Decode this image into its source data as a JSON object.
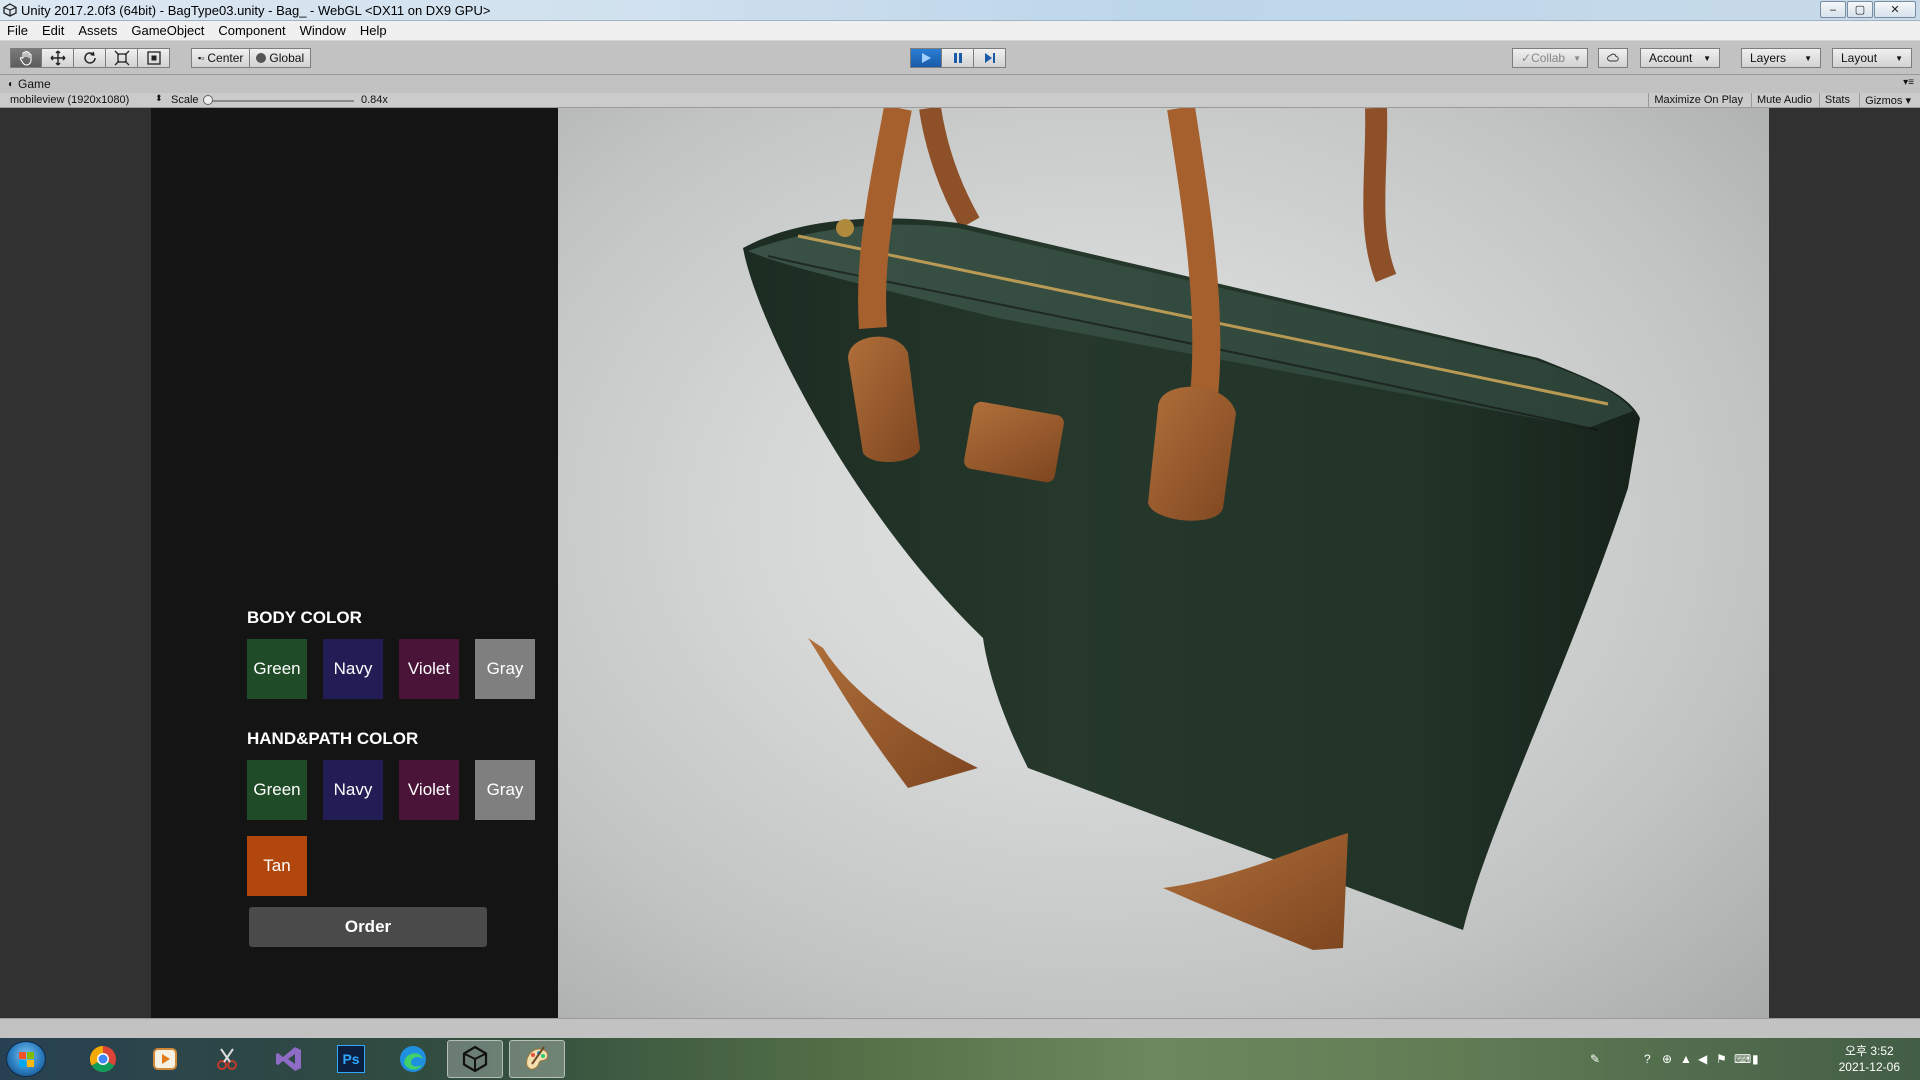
{
  "window": {
    "title": "Unity 2017.2.0f3 (64bit) - BagType03.unity - Bag_ - WebGL <DX11 on DX9 GPU>",
    "minimize": "–",
    "maximize": "▢",
    "close": "✕"
  },
  "menu": [
    "File",
    "Edit",
    "Assets",
    "GameObject",
    "Component",
    "Window",
    "Help"
  ],
  "toolbar": {
    "pivot_mode": "Center",
    "pivot_rotation": "Global",
    "collab": "Collab",
    "account": "Account",
    "layers": "Layers",
    "layout": "Layout"
  },
  "game_tab": {
    "label": "Game"
  },
  "game_bar": {
    "resolution": "mobileview (1920x1080)",
    "scale_label": "Scale",
    "scale_value": "0.84",
    "scale_fraction": 0.84,
    "maximize_on_play": "Maximize On Play",
    "mute_audio": "Mute Audio",
    "stats": "Stats",
    "gizmos": "Gizmos"
  },
  "panel": {
    "body_title": "BODY COLOR",
    "body_swatches": [
      {
        "label": "Green",
        "color": "#1f4b27"
      },
      {
        "label": "Navy",
        "color": "#231d55"
      },
      {
        "label": "Violet",
        "color": "#4a1438"
      },
      {
        "label": "Gray",
        "color": "#7f7f7f"
      }
    ],
    "hand_title": "HAND&PATH COLOR",
    "hand_swatches": [
      {
        "label": "Green",
        "color": "#1f4b27"
      },
      {
        "label": "Navy",
        "color": "#231d55"
      },
      {
        "label": "Violet",
        "color": "#4a1438"
      },
      {
        "label": "Gray",
        "color": "#7f7f7f"
      },
      {
        "label": "Tan",
        "color": "#b2470d"
      }
    ],
    "order_label": "Order"
  },
  "taskbar": {
    "apps": [
      "chrome-icon",
      "media-player-icon",
      "snipping-icon",
      "visual-studio-icon",
      "photoshop-icon",
      "edge-icon",
      "unity-icon",
      "paint-icon"
    ],
    "photoshop_text": "Ps",
    "clock_time": "오후 3:52",
    "clock_date": "2021-12-06"
  }
}
